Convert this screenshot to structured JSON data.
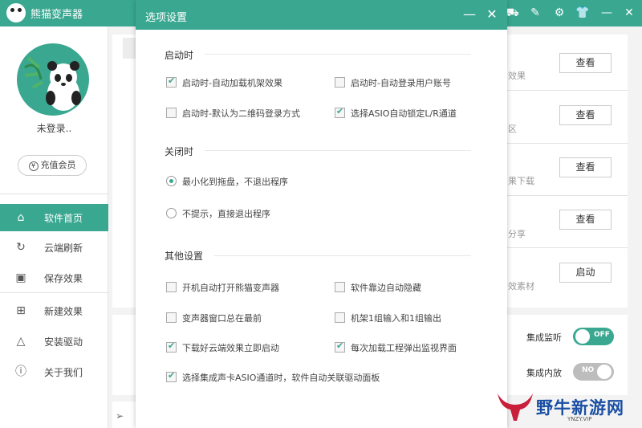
{
  "app": {
    "title": "熊猫变声器"
  },
  "sidebar": {
    "login_status": "未登录..",
    "vip_button": "充值会员",
    "vip_icon": "¥",
    "items": [
      {
        "label": "软件首页",
        "icon": "home-icon",
        "active": true
      },
      {
        "label": "云端刷新",
        "icon": "refresh-icon"
      },
      {
        "label": "保存效果",
        "icon": "save-icon"
      },
      {
        "label": "新建效果",
        "icon": "add-icon"
      },
      {
        "label": "安装驱动",
        "icon": "drive-icon"
      },
      {
        "label": "关于我们",
        "icon": "info-icon"
      }
    ]
  },
  "content": {
    "rows": [
      {
        "label": "效果",
        "button": "查看"
      },
      {
        "label": "区",
        "button": "查看"
      },
      {
        "label": "果下载",
        "button": "查看"
      },
      {
        "label": "分享",
        "button": "查看"
      },
      {
        "label": "效素材",
        "button": "启动"
      }
    ],
    "monitor": {
      "label": "集成监听",
      "state": "OFF"
    },
    "internal": {
      "label": "集成内放",
      "state": "NO"
    }
  },
  "dialog": {
    "title": "选项设置",
    "sections": {
      "startup": {
        "title": "启动时",
        "options": [
          {
            "label": "启动时-自动加载机架效果",
            "checked": true
          },
          {
            "label": "启动时-自动登录用户账号",
            "checked": false
          },
          {
            "label": "启动时-默认为二维码登录方式",
            "checked": false
          },
          {
            "label": "选择ASIO自动锁定L/R通道",
            "checked": true
          }
        ]
      },
      "close": {
        "title": "关闭时",
        "options": [
          {
            "label": "最小化到拖盘，不退出程序",
            "checked": true
          },
          {
            "label": "不提示，直接退出程序",
            "checked": false
          }
        ]
      },
      "other": {
        "title": "其他设置",
        "options": [
          {
            "label": "开机自动打开熊猫变声器",
            "checked": false
          },
          {
            "label": "软件靠边自动隐藏",
            "checked": false
          },
          {
            "label": "变声器窗口总在最前",
            "checked": false
          },
          {
            "label": "机架1组输入和1组输出",
            "checked": false
          },
          {
            "label": "下载好云端效果立即启动",
            "checked": true
          },
          {
            "label": "每次加载工程弹出监视界面",
            "checked": true
          },
          {
            "label": "选择集成声卡ASIO通道时，软件自动关联驱动面板",
            "checked": true
          }
        ]
      }
    }
  },
  "watermark": {
    "text": "野牛新游网",
    "sub": "YNZY.VIP"
  },
  "colors": {
    "accent": "#3aa791",
    "watermark": "#1a4fa3"
  }
}
